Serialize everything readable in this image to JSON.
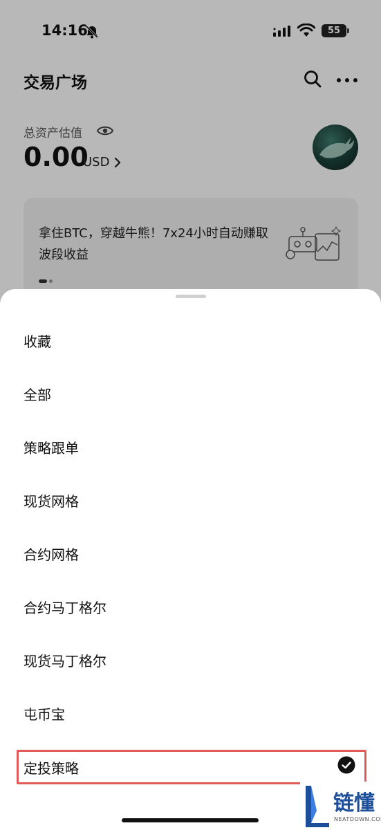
{
  "status_bar": {
    "time": "14:16",
    "battery": "55"
  },
  "header": {
    "title": "交易广场"
  },
  "assets": {
    "label": "总资产估值",
    "value": "0.00",
    "unit": "USD"
  },
  "banner": {
    "text": "拿住BTC，穿越牛熊！7x24小时自动赚取波段收益"
  },
  "sheet": {
    "items": [
      {
        "label": "收藏"
      },
      {
        "label": "全部"
      },
      {
        "label": "策略跟单"
      },
      {
        "label": "现货网格"
      },
      {
        "label": "合约网格"
      },
      {
        "label": "合约马丁格尔"
      },
      {
        "label": "现货马丁格尔"
      },
      {
        "label": "屯币宝"
      },
      {
        "label": "定投策略",
        "selected": true
      }
    ]
  },
  "watermark": {
    "text": "链懂",
    "sub": "NEATDOWN.COM"
  },
  "colors": {
    "highlight_border": "#e15a5a",
    "watermark_blue": "#1d4e9a"
  }
}
